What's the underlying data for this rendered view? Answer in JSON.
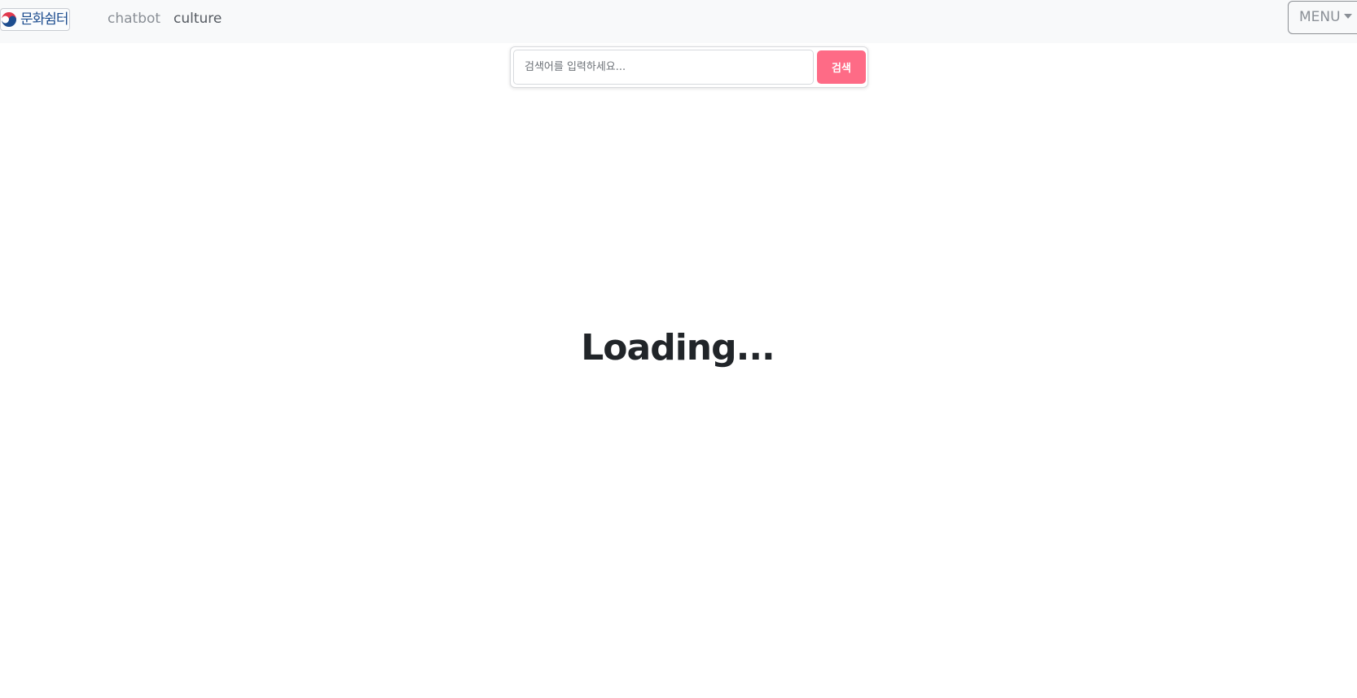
{
  "navbar": {
    "logo_text": "문화쉼터",
    "links": [
      {
        "label": "chatbot"
      },
      {
        "label": "culture"
      }
    ],
    "menu_label": "MENU"
  },
  "search": {
    "placeholder": "검색어를 입력하세요...",
    "value": "",
    "button_label": "검색"
  },
  "main": {
    "loading_text": "Loading..."
  },
  "colors": {
    "navbar_bg": "#f8f9fa",
    "search_button": "#fe6b86",
    "loading_text": "#212529",
    "nav_link": "#8a8f96",
    "nav_link_active": "#555a61"
  },
  "icons": {
    "logo_emblem": "taegeuk-emblem-icon",
    "menu_caret": "caret-down-icon"
  }
}
